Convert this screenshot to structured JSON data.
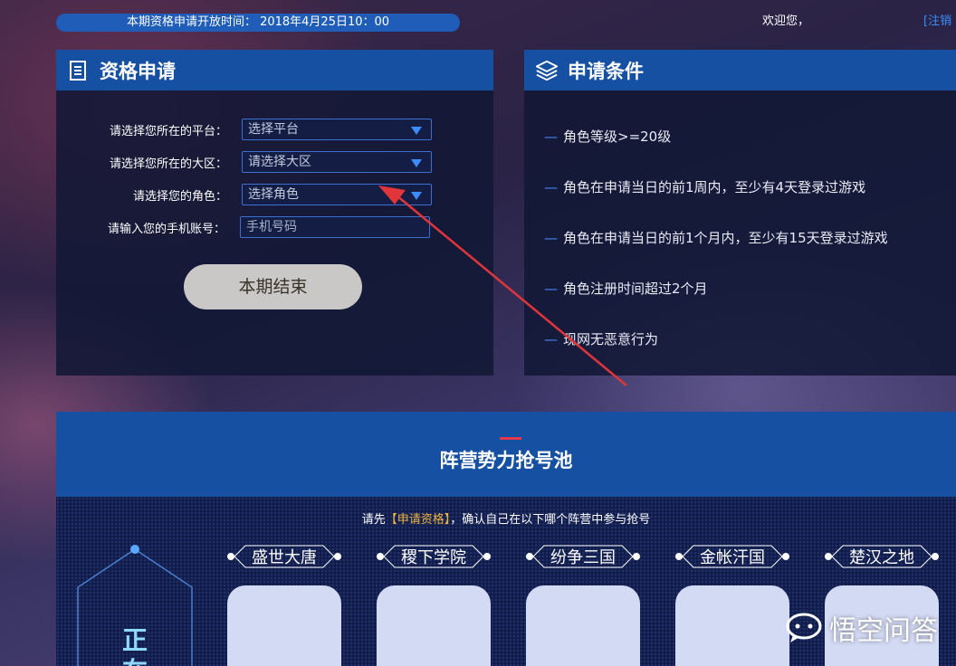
{
  "top_bar": {
    "notice": "本期资格申请开放时间： 2018年4月25日10：00",
    "welcome": "欢迎您，",
    "logout": "[注销"
  },
  "apply_panel": {
    "title": "资格申请",
    "rows": [
      {
        "label": "请选择您所在的平台：",
        "value": "选择平台"
      },
      {
        "label": "请选择您所在的大区：",
        "value": "请选择大区"
      },
      {
        "label": "请选择您的角色：",
        "value": "选择角色"
      },
      {
        "label": "请输入您的手机账号：",
        "placeholder": "手机号码"
      }
    ],
    "button": "本期结束"
  },
  "conditions_panel": {
    "title": "申请条件",
    "dash": "—",
    "items": [
      "角色等级>=20级",
      "角色在申请当日的前1周内，至少有4天登录过游戏",
      "角色在申请当日的前1个月内，至少有15天登录过游戏",
      "角色注册时间超过2个月",
      "现网无恶意行为"
    ]
  },
  "pool": {
    "title": "阵营势力抢号池",
    "note_prefix": "请先",
    "note_highlight": "【申请资格】",
    "note_suffix": "，确认自己在以下哪个阵营中参与抢号",
    "status": "正在",
    "factions": [
      "盛世大唐",
      "稷下学院",
      "纷争三国",
      "金帐汗国",
      "楚汉之地"
    ]
  },
  "watermark": "悟空问答",
  "colors": {
    "accent_blue": "#1650a3",
    "highlight_orange": "#f0b540",
    "arrow_red": "#e0353a"
  }
}
